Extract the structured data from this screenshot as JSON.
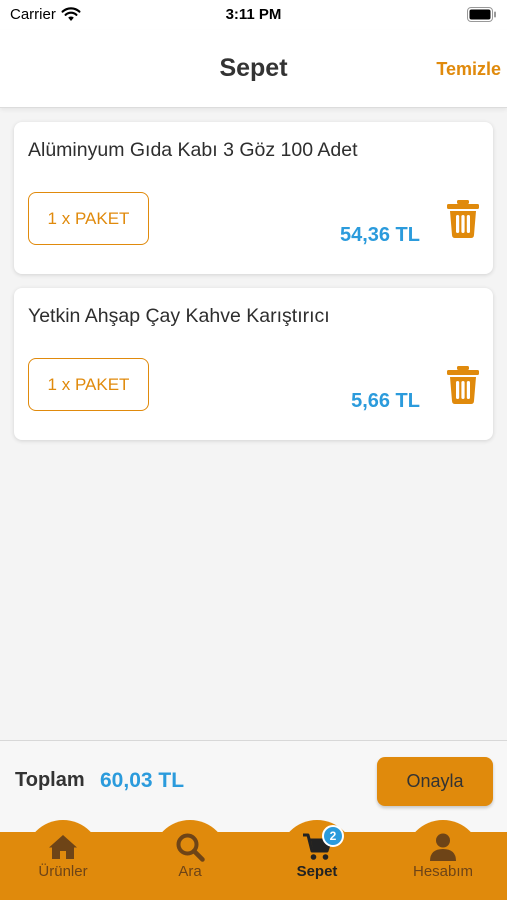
{
  "status_bar": {
    "carrier": "Carrier",
    "time": "3:11 PM"
  },
  "header": {
    "title": "Sepet",
    "clear_label": "Temizle"
  },
  "cart": {
    "items": [
      {
        "name": "Alüminyum Gıda Kabı 3 Göz 100 Adet",
        "quantity": "1 x PAKET",
        "price": "54,36 TL"
      },
      {
        "name": "Yetkin Ahşap Çay Kahve Karıştırıcı",
        "quantity": "1 x PAKET",
        "price": "5,66 TL"
      }
    ]
  },
  "summary": {
    "total_label": "Toplam",
    "total_value": "60,03 TL",
    "confirm_label": "Onayla"
  },
  "tabs": [
    {
      "label": "Ürünler",
      "icon": "home-icon"
    },
    {
      "label": "Ara",
      "icon": "search-icon"
    },
    {
      "label": "Sepet",
      "icon": "cart-icon",
      "badge": "2",
      "active": true
    },
    {
      "label": "Hesabım",
      "icon": "user-icon"
    }
  ],
  "colors": {
    "accent": "#e08a0c",
    "price": "#2b9bdc",
    "tab_inactive": "#6e4417"
  }
}
